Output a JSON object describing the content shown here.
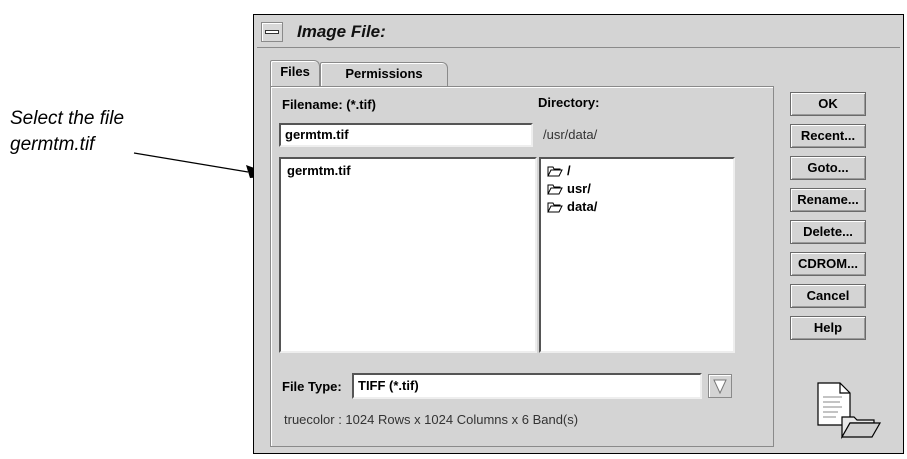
{
  "annotation": {
    "line1": "Select the file",
    "line2": "germtm.tif"
  },
  "window": {
    "title": "Image File:"
  },
  "tabs": [
    {
      "label": "Files",
      "active": true
    },
    {
      "label": "Permissions",
      "active": false
    }
  ],
  "files_panel": {
    "filename_label": "Filename: (*.tif)",
    "filename_value": "germtm.tif",
    "directory_label": "Directory:",
    "directory_value": "/usr/data/",
    "file_list": [
      "germtm.tif"
    ],
    "directory_list": [
      "/",
      "usr/",
      "data/"
    ],
    "filetype_label": "File Type:",
    "filetype_value": "TIFF (*.tif)",
    "info_text": "truecolor : 1024 Rows x 1024 Columns x 6 Band(s)"
  },
  "buttons": {
    "ok": "OK",
    "recent": "Recent...",
    "goto": "Goto...",
    "rename": "Rename...",
    "delete": "Delete...",
    "cdrom": "CDROM...",
    "cancel": "Cancel",
    "help": "Help"
  },
  "icons": {
    "window_menu": "window-menu-icon",
    "folder": "folder-open-icon",
    "dropdown": "dropdown-triangle-icon",
    "document": "document-folder-icon"
  },
  "colors": {
    "dialog_bg": "#d4d4d4",
    "field_bg": "#ffffff"
  }
}
